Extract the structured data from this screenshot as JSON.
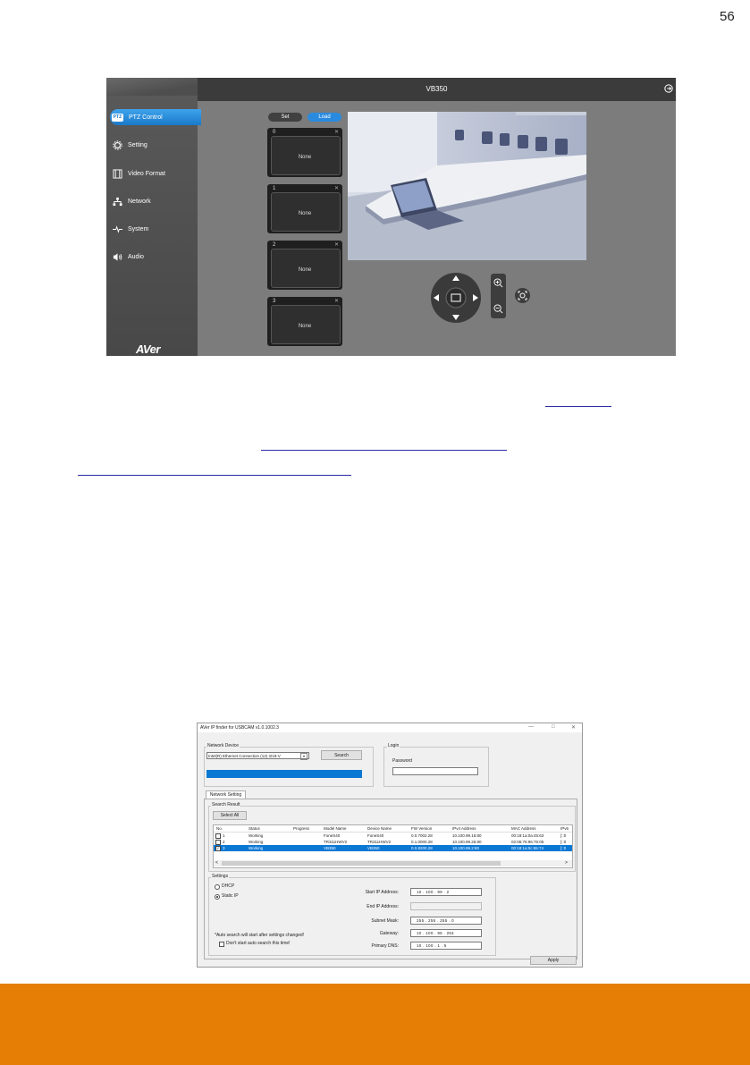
{
  "page": {
    "number": "56"
  },
  "webui": {
    "title": "VB350",
    "nav": [
      {
        "label": "PTZ Control",
        "icon": "ptz-icon"
      },
      {
        "label": "Setting",
        "icon": "gear-icon"
      },
      {
        "label": "Video Format",
        "icon": "film-icon"
      },
      {
        "label": "Network",
        "icon": "network-icon"
      },
      {
        "label": "System",
        "icon": "pulse-icon"
      },
      {
        "label": "Audio",
        "icon": "speaker-icon"
      }
    ],
    "ptz_badge": "PTZ",
    "logo": "AVer",
    "buttons": {
      "set": "Set",
      "load": "Load"
    },
    "presets": [
      {
        "number": "0",
        "name": "None"
      },
      {
        "number": "1",
        "name": "None"
      },
      {
        "number": "2",
        "name": "None"
      },
      {
        "number": "3",
        "name": "None"
      }
    ],
    "colors": {
      "accent": "#1a79c9",
      "topbar": "#3b3b3b",
      "sidebar": "#4f4f4f"
    }
  },
  "ipfinder": {
    "title": "AVer IP finder for USBCAM v1.0.1002.3",
    "network_device_label": "Network Device",
    "network_device_value": "Intel(R) Ethernet Connection (12) I219-V",
    "search_button": "Search",
    "login_label": "Login",
    "password_label": "Password",
    "tab": "Network Setting",
    "search_result_label": "Search Result",
    "select_all": "Select All",
    "columns": [
      "No.",
      "Status",
      "Progress",
      "Model Name",
      "Device Name",
      "FW Version",
      "IPv4 Address",
      "MAC Address",
      "IPv6"
    ],
    "rows": [
      {
        "no": "1",
        "status": "Working",
        "progress": "",
        "model": "FoneS40",
        "device": "FoneS40",
        "fw": "0.0.7002.28",
        "ipv4": "10.100.99.16:80",
        "mac": "00:18:1a:0a:45:63",
        "ipv6": "[::0"
      },
      {
        "no": "2",
        "status": "Working",
        "progress": "",
        "model": "TR311HWV2",
        "device": "TR311HWV2",
        "fw": "0.1.0000.28",
        "ipv4": "10.100.99.26:80",
        "mac": "02:06:76:96:76:05",
        "ipv6": "[::0"
      },
      {
        "no": "3",
        "status": "Working",
        "progress": "",
        "model": "VB350",
        "device": "VB350",
        "fw": "0.0.8200.28",
        "ipv4": "10.100.99.2:80",
        "mac": "00:18:1a:0c:65:74",
        "ipv6": "[::0"
      }
    ],
    "settings_label": "Settings",
    "dhcp_label": "DHCP",
    "static_label": "Static IP",
    "note": "*Auto search will start after settings changed!",
    "dont_search": "Don't start auto search this time!",
    "fields": [
      {
        "label": "Start IP Address:",
        "value": "10  .  100  .  99  .  2",
        "disabled": false
      },
      {
        "label": "End IP Address:",
        "value": ".     .     .",
        "disabled": true
      },
      {
        "label": "Subnet Mask:",
        "value": "255  .  255  .  255  .  0",
        "disabled": false
      },
      {
        "label": "Gateway:",
        "value": "10  .  100  .  95  .  254",
        "disabled": false
      },
      {
        "label": "Primary DNS:",
        "value": "10  .  100  .  1  .  5",
        "disabled": false
      }
    ],
    "apply": "Apply",
    "window_controls": {
      "minimize": "—",
      "maximize": "□",
      "close": "✕"
    }
  },
  "footer": {
    "color": "#e67e06"
  }
}
